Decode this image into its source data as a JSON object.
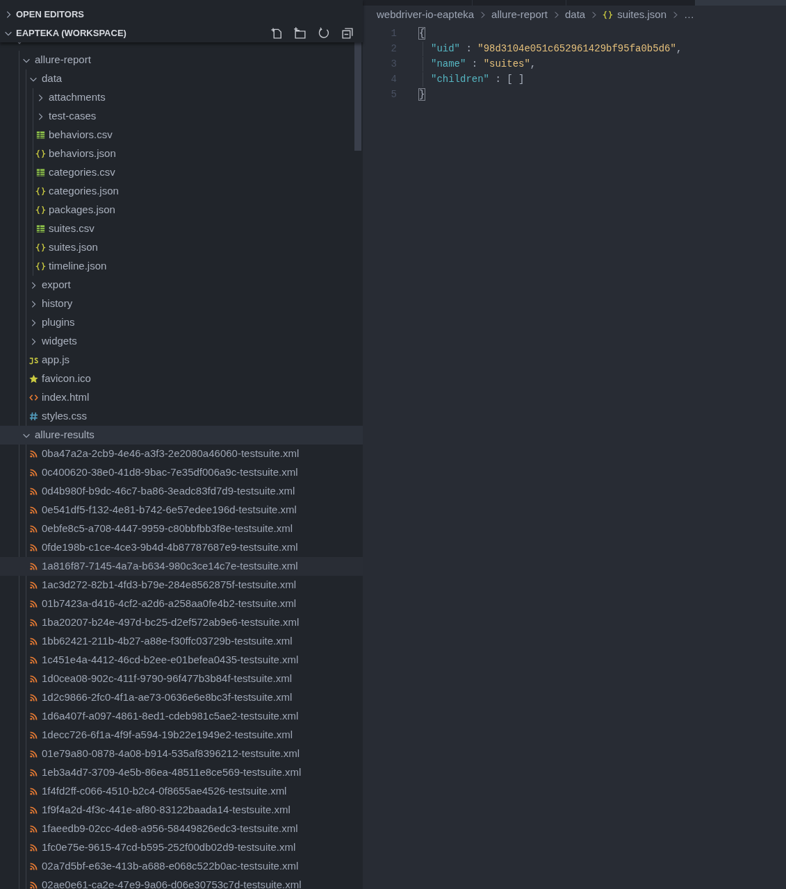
{
  "sidebar": {
    "sections": [
      {
        "label": "OPEN EDITORS",
        "expanded": false
      },
      {
        "label": "EAPTEKA (WORKSPACE)",
        "expanded": true
      }
    ],
    "tree": [
      {
        "kind": "folder",
        "expanded": true,
        "children": [
          {
            "label": "allure-report",
            "kind": "folder",
            "expanded": true,
            "selected": false,
            "children": [
              {
                "label": "data",
                "kind": "folder",
                "expanded": true,
                "children": [
                  {
                    "label": "attachments",
                    "kind": "folder",
                    "expanded": false
                  },
                  {
                    "label": "test-cases",
                    "kind": "folder",
                    "expanded": false
                  },
                  {
                    "label": "behaviors.csv",
                    "kind": "csv"
                  },
                  {
                    "label": "behaviors.json",
                    "kind": "json"
                  },
                  {
                    "label": "categories.csv",
                    "kind": "csv"
                  },
                  {
                    "label": "categories.json",
                    "kind": "json"
                  },
                  {
                    "label": "packages.json",
                    "kind": "json"
                  },
                  {
                    "label": "suites.csv",
                    "kind": "csv"
                  },
                  {
                    "label": "suites.json",
                    "kind": "json"
                  },
                  {
                    "label": "timeline.json",
                    "kind": "json"
                  }
                ]
              },
              {
                "label": "export",
                "kind": "folder",
                "expanded": false
              },
              {
                "label": "history",
                "kind": "folder",
                "expanded": false
              },
              {
                "label": "plugins",
                "kind": "folder",
                "expanded": false
              },
              {
                "label": "widgets",
                "kind": "folder",
                "expanded": false
              },
              {
                "label": "app.js",
                "kind": "js"
              },
              {
                "label": "favicon.ico",
                "kind": "ico"
              },
              {
                "label": "index.html",
                "kind": "html"
              },
              {
                "label": "styles.css",
                "kind": "css"
              }
            ]
          },
          {
            "label": "allure-results",
            "kind": "folder",
            "expanded": true,
            "selected": true,
            "children": [
              {
                "label": "0ba47a2a-2cb9-4e46-a3f3-2e2080a46060-testsuite.xml",
                "kind": "xml",
                "hovered": false
              },
              {
                "label": "0c400620-38e0-41d8-9bac-7e35df006a9c-testsuite.xml",
                "kind": "xml",
                "hovered": false
              },
              {
                "label": "0d4b980f-b9dc-46c7-ba86-3eadc83fd7d9-testsuite.xml",
                "kind": "xml",
                "hovered": false
              },
              {
                "label": "0e541df5-f132-4e81-b742-6e57edee196d-testsuite.xml",
                "kind": "xml",
                "hovered": false
              },
              {
                "label": "0ebfe8c5-a708-4447-9959-c80bbfbb3f8e-testsuite.xml",
                "kind": "xml",
                "hovered": false
              },
              {
                "label": "0fde198b-c1ce-4ce3-9b4d-4b87787687e9-testsuite.xml",
                "kind": "xml",
                "hovered": false
              },
              {
                "label": "1a816f87-7145-4a7a-b634-980c3ce14c7e-testsuite.xml",
                "kind": "xml",
                "hovered": true
              },
              {
                "label": "1ac3d272-82b1-4fd3-b79e-284e8562875f-testsuite.xml",
                "kind": "xml",
                "hovered": false
              },
              {
                "label": "01b7423a-d416-4cf2-a2d6-a258aa0fe4b2-testsuite.xml",
                "kind": "xml",
                "hovered": false
              },
              {
                "label": "1ba20207-b24e-497d-bc25-d2ef572ab9e6-testsuite.xml",
                "kind": "xml",
                "hovered": false
              },
              {
                "label": "1bb62421-211b-4b27-a88e-f30ffc03729b-testsuite.xml",
                "kind": "xml",
                "hovered": false
              },
              {
                "label": "1c451e4a-4412-46cd-b2ee-e01befea0435-testsuite.xml",
                "kind": "xml",
                "hovered": false
              },
              {
                "label": "1d0cea08-902c-411f-9790-96f477b3b84f-testsuite.xml",
                "kind": "xml",
                "hovered": false
              },
              {
                "label": "1d2c9866-2fc0-4f1a-ae73-0636e6e8bc3f-testsuite.xml",
                "kind": "xml",
                "hovered": false
              },
              {
                "label": "1d6a407f-a097-4861-8ed1-cdeb981c5ae2-testsuite.xml",
                "kind": "xml",
                "hovered": false
              },
              {
                "label": "1decc726-6f1a-4f9f-a594-19b22e1949e2-testsuite.xml",
                "kind": "xml",
                "hovered": false
              },
              {
                "label": "01e79a80-0878-4a08-b914-535af8396212-testsuite.xml",
                "kind": "xml",
                "hovered": false
              },
              {
                "label": "1eb3a4d7-3709-4e5b-86ea-48511e8ce569-testsuite.xml",
                "kind": "xml",
                "hovered": false
              },
              {
                "label": "1f4fd2ff-c066-4510-b2c4-0f8655ae4526-testsuite.xml",
                "kind": "xml",
                "hovered": false
              },
              {
                "label": "1f9f4a2d-4f3c-441e-af80-83122baada14-testsuite.xml",
                "kind": "xml",
                "hovered": false
              },
              {
                "label": "1faeedb9-02cc-4de8-a956-58449826edc3-testsuite.xml",
                "kind": "xml",
                "hovered": false
              },
              {
                "label": "1fc0e75e-9615-47cd-b595-252f00db02d9-testsuite.xml",
                "kind": "xml",
                "hovered": false
              },
              {
                "label": "02a7d5bf-e63e-413b-a688-e068c522b0ac-testsuite.xml",
                "kind": "xml",
                "hovered": false
              },
              {
                "label": "02ae0e61-ca2e-47e9-9a06-d06e30753c7d-testsuite.xml",
                "kind": "xml",
                "hovered": false
              }
            ]
          }
        ]
      }
    ]
  },
  "editor": {
    "breadcrumb": [
      {
        "label": "webdriver-io-eapteka",
        "kind": "folder"
      },
      {
        "label": "allure-report",
        "kind": "folder"
      },
      {
        "label": "data",
        "kind": "folder"
      },
      {
        "label": "suites.json",
        "kind": "json"
      },
      {
        "label": "…",
        "kind": "more"
      }
    ],
    "lines": [
      {
        "number": "1",
        "tokens": [
          {
            "kind": "bracket",
            "text": "{"
          }
        ]
      },
      {
        "number": "2",
        "tokens": [
          {
            "kind": "key",
            "text": "\"uid\""
          },
          {
            "kind": "punct",
            "text": " : "
          },
          {
            "kind": "string",
            "text": "\"98d3104e051c652961429bf95fa0b5d6\""
          },
          {
            "kind": "punct",
            "text": ","
          }
        ]
      },
      {
        "number": "3",
        "tokens": [
          {
            "kind": "key",
            "text": "\"name\""
          },
          {
            "kind": "punct",
            "text": " : "
          },
          {
            "kind": "string",
            "text": "\"suites\""
          },
          {
            "kind": "punct",
            "text": ","
          }
        ]
      },
      {
        "number": "4",
        "tokens": [
          {
            "kind": "key",
            "text": "\"children\""
          },
          {
            "kind": "punct",
            "text": " : [ ]"
          }
        ]
      },
      {
        "number": "5",
        "tokens": [
          {
            "kind": "bracket",
            "text": "}"
          }
        ]
      }
    ]
  }
}
